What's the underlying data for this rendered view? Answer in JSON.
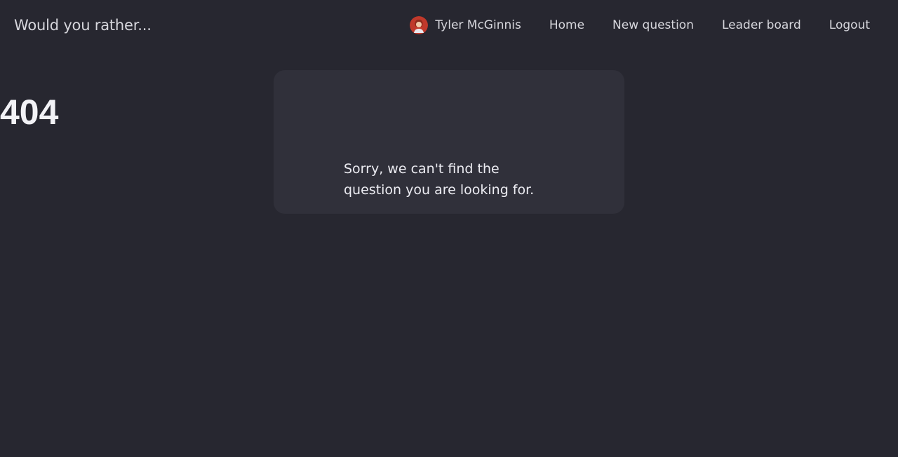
{
  "header": {
    "brand": "Would you rather...",
    "user": {
      "name": "Tyler McGinnis",
      "avatar_icon": "user-avatar-icon"
    },
    "nav": [
      {
        "label": "Home"
      },
      {
        "label": "New question"
      },
      {
        "label": "Leader board"
      },
      {
        "label": "Logout"
      }
    ]
  },
  "error": {
    "code": "404",
    "message": "Sorry, we can't find the question you are looking for."
  },
  "colors": {
    "background": "#272730",
    "card": "#30303a",
    "text": "#e8e8ee",
    "avatar_bg": "#c0392b"
  }
}
